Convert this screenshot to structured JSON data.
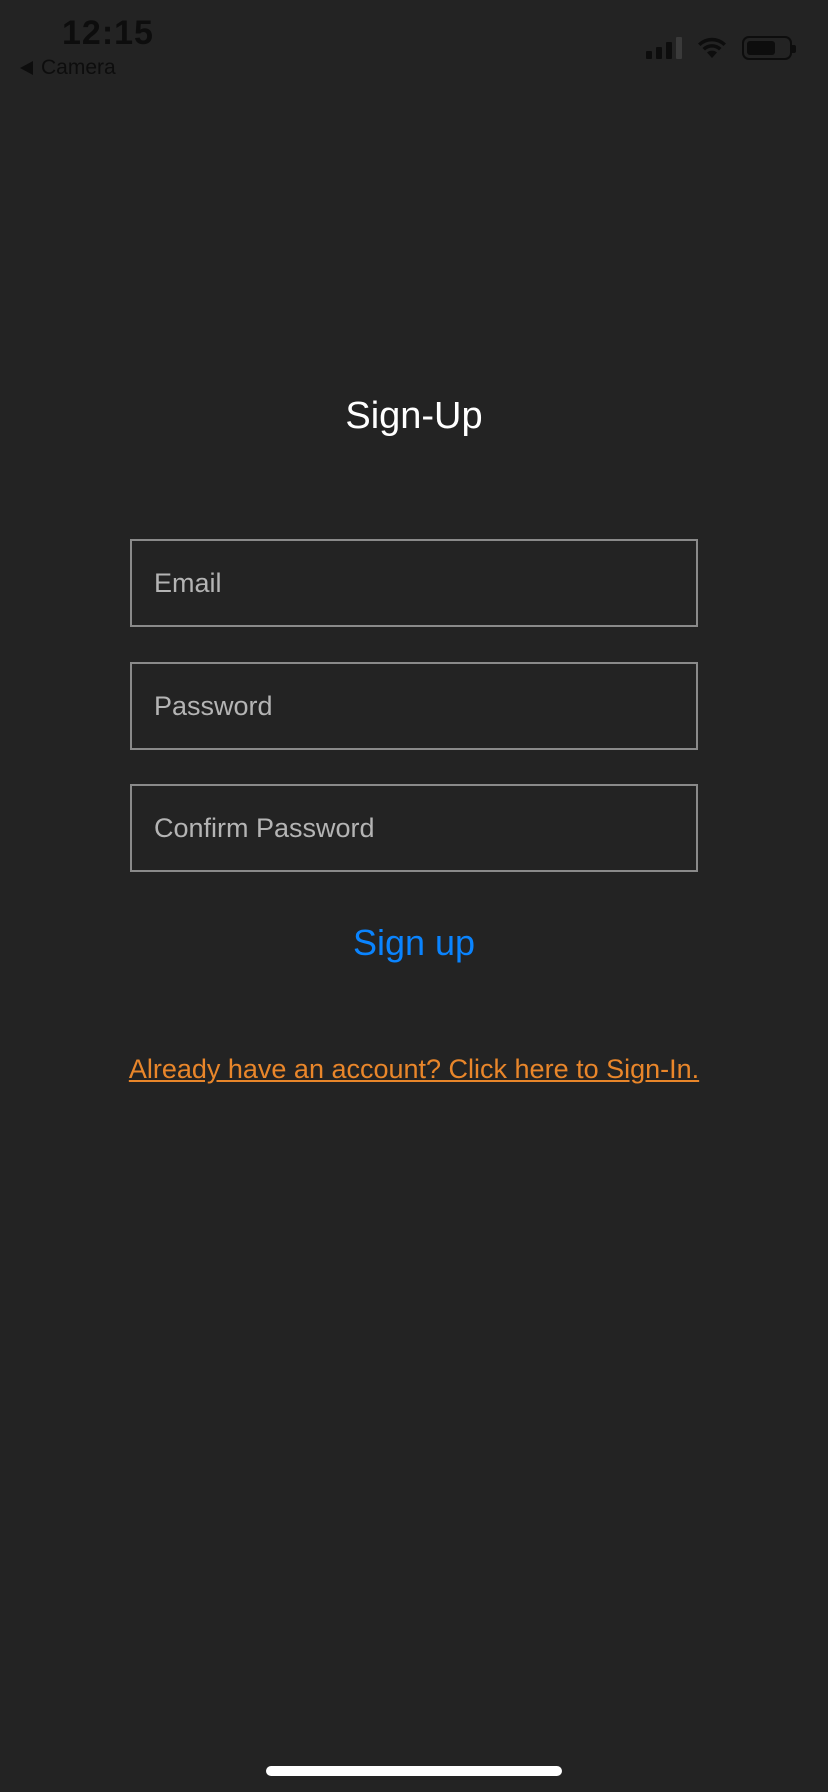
{
  "status_bar": {
    "time": "12:15",
    "back_label": "Camera",
    "icons": [
      "signal-icon",
      "wifi-icon",
      "battery-icon"
    ]
  },
  "form": {
    "title": "Sign-Up",
    "email_placeholder": "Email",
    "password_placeholder": "Password",
    "confirm_password_placeholder": "Confirm Password",
    "email_value": "",
    "password_value": "",
    "confirm_password_value": "",
    "submit_label": "Sign up",
    "signin_link": "Already have an account? Click here to Sign-In."
  },
  "colors": {
    "background": "#232323",
    "accent_blue": "#0a84ff",
    "link_orange": "#e9862a",
    "field_border": "#8a8a8a"
  }
}
